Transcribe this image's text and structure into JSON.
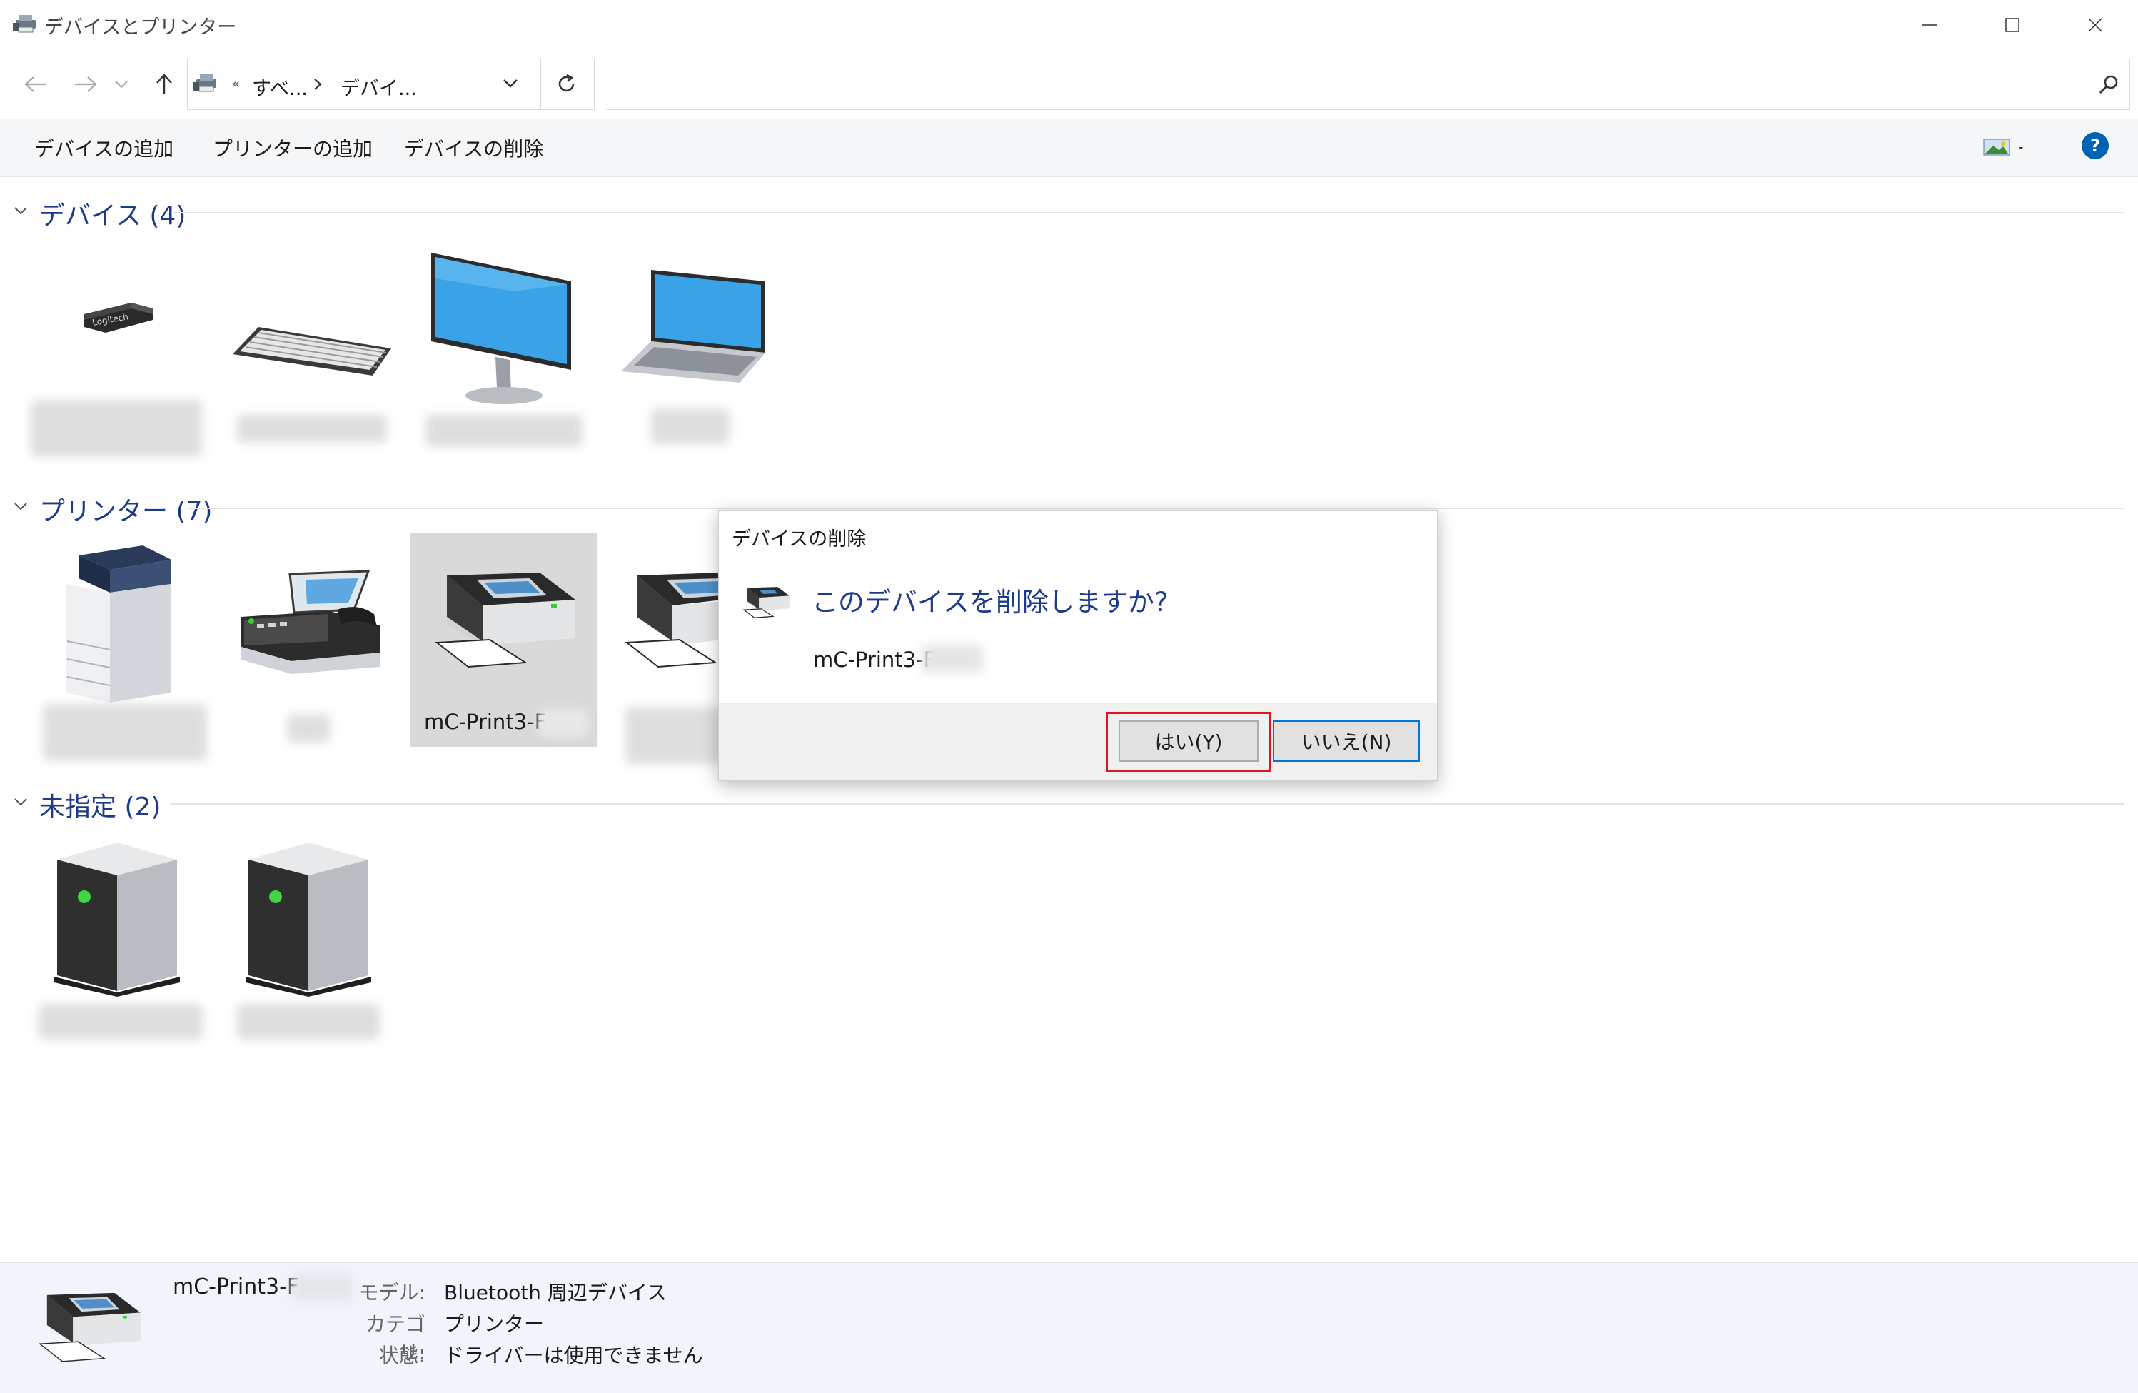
{
  "window": {
    "title": "デバイスとプリンター",
    "controls": [
      "minimize",
      "maximize",
      "close"
    ]
  },
  "address_bar": {
    "overflow": "«",
    "crumbs": [
      "すべ...",
      "デバイ..."
    ],
    "search_value": ""
  },
  "command_bar": {
    "add_device": "デバイスの追加",
    "add_printer": "プリンターの追加",
    "remove_device": "デバイスの削除",
    "help": "?"
  },
  "groups": {
    "devices": {
      "title": "デバイス (4)",
      "items": [
        "logitech-receiver",
        "keyboard",
        "monitor",
        "laptop"
      ]
    },
    "printers": {
      "title": "プリンター (7)",
      "selected_label": "mC-Print3-F"
    },
    "unspecified": {
      "title": "未指定 (2)"
    }
  },
  "dialog": {
    "title": "デバイスの削除",
    "question": "このデバイスを削除しますか?",
    "device_name": "mC-Print3-F",
    "yes_button": "はい(Y)",
    "no_button": "いいえ(N)",
    "highlight_color": "#e0141e"
  },
  "details": {
    "name": "mC-Print3-F",
    "model_label": "モデル:",
    "model_value": "Bluetooth 周辺デバイス",
    "category_label": "カテゴリ:",
    "category_value": "プリンター",
    "status_label": "状態:",
    "status_value": "ドライバーは使用できません"
  },
  "colors": {
    "group_title": "#1e3a8a",
    "accent": "#0063b1",
    "selection": "#d9d9d9"
  }
}
